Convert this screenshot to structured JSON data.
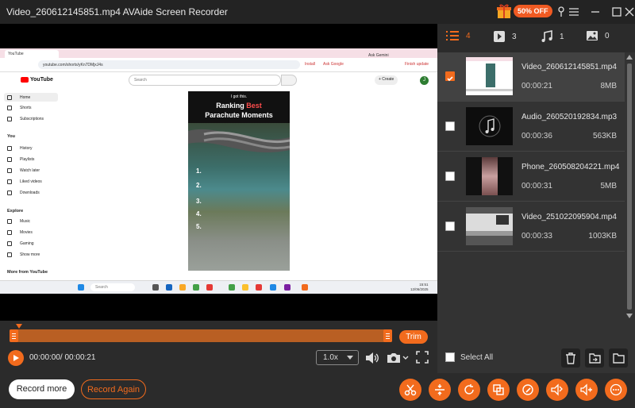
{
  "window": {
    "title": "Video_260612145851.mp4   AVAide Screen Recorder",
    "promo_badge": "50% OFF"
  },
  "colors": {
    "accent": "#f26b1d",
    "panel": "#333333",
    "background": "#2b2b2b"
  },
  "screen": {
    "tab_label": "YouTube",
    "url": "youtube.com/shorts/yKn7DMjxJ4s",
    "url_actions": [
      "Install",
      "Ask Google",
      "Ask Gemini",
      "Finish update"
    ],
    "youtube_logo": "YouTube",
    "search_placeholder": "Search",
    "create_label": "+ Create",
    "avatar_letter": "J",
    "sidebar": {
      "top": [
        "Home",
        "Shorts",
        "Subscriptions"
      ],
      "you_header": "You",
      "you": [
        "History",
        "Playlists",
        "Watch later",
        "Liked videos",
        "Downloads"
      ],
      "explore_header": "Explore",
      "explore": [
        "Music",
        "Movies",
        "Gaming",
        "Show more"
      ],
      "more_header": "More from YouTube"
    },
    "short": {
      "caption": "I got this.",
      "title_line1": "Ranking",
      "title_line1b": "Best",
      "title_line2": "Parachute Moments",
      "numbers": [
        "1.",
        "2.",
        "3.",
        "4.",
        "5."
      ]
    },
    "taskbar": {
      "search": "Search",
      "clock_time": "15:51",
      "clock_date": "12/06/2025",
      "lang": "ENG\nUS"
    }
  },
  "player": {
    "time": "00:00:00/ 00:00:21",
    "speed": "1.0x",
    "trim_label": "Trim",
    "progress": 0.0
  },
  "buttons": {
    "record_more": "Record more",
    "record_again": "Record Again"
  },
  "tabs": [
    {
      "icon": "list-icon",
      "count": "4"
    },
    {
      "icon": "video-icon",
      "count": "3"
    },
    {
      "icon": "music-icon",
      "count": "1"
    },
    {
      "icon": "image-icon",
      "count": "0"
    }
  ],
  "files": [
    {
      "name": "Video_260612145851.mp4",
      "duration": "00:00:21",
      "size": "8MB",
      "checked": true
    },
    {
      "name": "Audio_260520192834.mp3",
      "duration": "00:00:36",
      "size": "563KB",
      "checked": false
    },
    {
      "name": "Phone_260508204221.mp4",
      "duration": "00:00:31",
      "size": "5MB",
      "checked": false
    },
    {
      "name": "Video_251022095904.mp4",
      "duration": "00:00:33",
      "size": "1003KB",
      "checked": false
    }
  ],
  "select_all": "Select All",
  "tools": [
    "scissors-icon",
    "merge-icon",
    "rotate-icon",
    "compress-icon",
    "edit-icon",
    "convert-icon",
    "volume-boost-icon",
    "more-icon"
  ]
}
